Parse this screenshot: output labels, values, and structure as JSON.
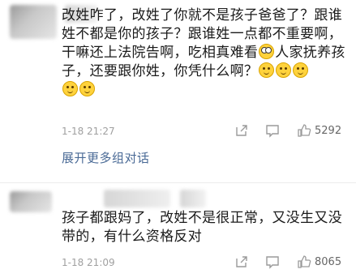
{
  "comments": [
    {
      "text": "改姓咋了，改姓了你就不是孩子爸爸了？跟谁姓不都是你的孩子？跟谁姓一点都不重要啊，干嘛还上法院告啊，吃相真难看",
      "text_tail": "人家抚养孩子，还要跟你姓，你凭什么啊？",
      "time": "1-18 21:27",
      "likes": "5292",
      "expand_label": "展开更多组对话"
    },
    {
      "text": "孩子都跟妈了，改姓不是很正常，又没生又没带的，有什么资格反对",
      "time": "1-18 21:09",
      "likes": "8065"
    }
  ],
  "icons": {
    "share": "share-icon",
    "comment": "comment-icon",
    "like": "thumbs-up-icon",
    "emoji": "smile-emoji-icon"
  },
  "colors": {
    "link": "#4a6a96",
    "meta": "#a0a0a0",
    "text": "#1a1a1a"
  }
}
